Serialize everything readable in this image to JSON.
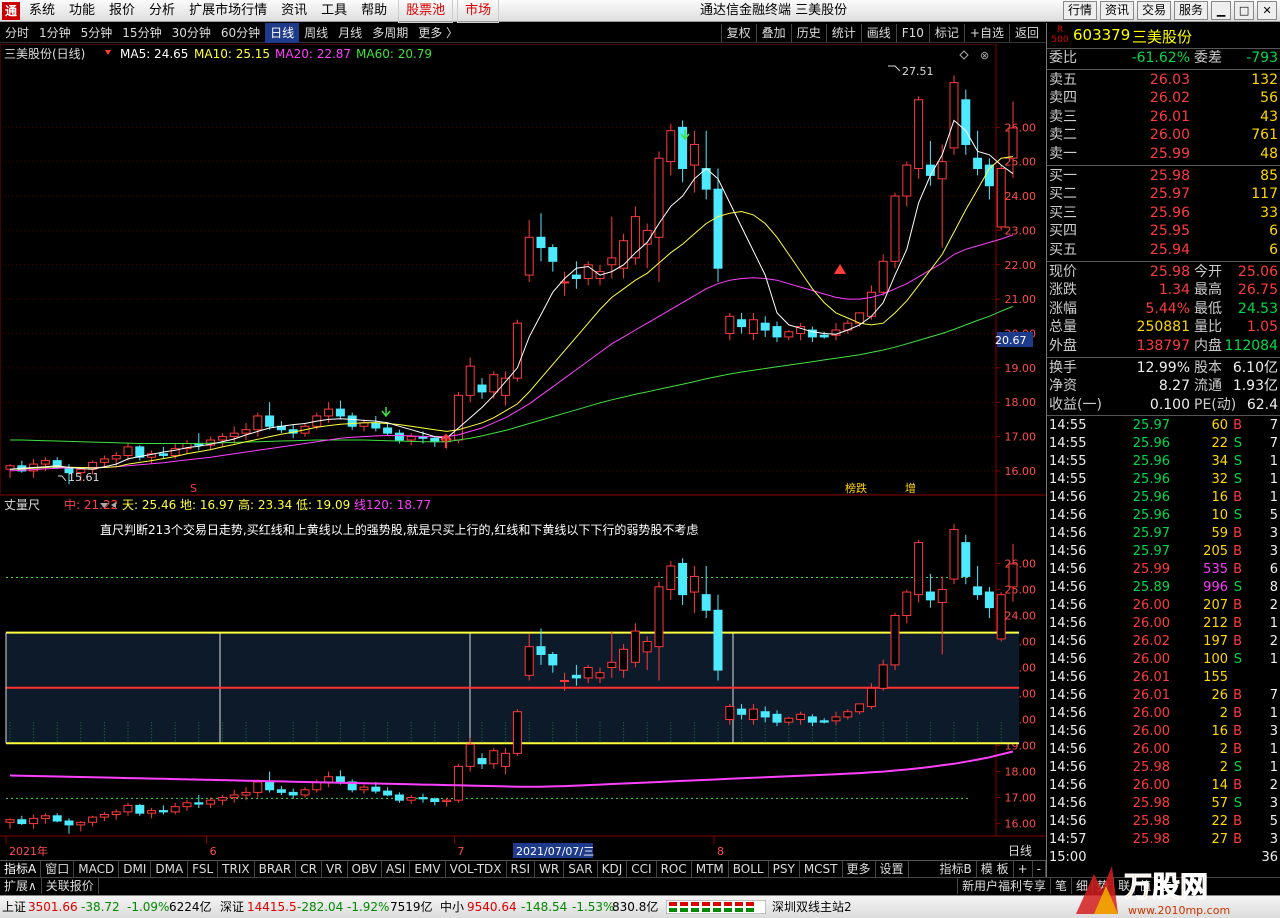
{
  "menu": {
    "items": [
      "系统",
      "功能",
      "报价",
      "分析",
      "扩展市场行情",
      "资讯",
      "工具",
      "帮助"
    ],
    "pool": "股票池",
    "market": "市场",
    "title": "通达信金融终端  三美股份",
    "rbtns": [
      "行情",
      "资讯",
      "交易",
      "服务"
    ]
  },
  "period": {
    "items": [
      "分时",
      "1分钟",
      "5分钟",
      "15分钟",
      "30分钟",
      "60分钟",
      "日线",
      "周线",
      "月线",
      "多周期",
      "更多 〉"
    ],
    "active": 6,
    "tools": [
      "复权",
      "叠加",
      "历史",
      "统计",
      "画线",
      "F10",
      "标记",
      "+自选",
      "返回"
    ]
  },
  "main_chart": {
    "title": "三美股份(日线)",
    "ma": [
      {
        "label": "MA5: 24.65",
        "color": "#ffffff"
      },
      {
        "label": "MA10: 25.15",
        "color": "#ffff40"
      },
      {
        "label": "MA20: 22.87",
        "color": "#ff40ff"
      },
      {
        "label": "MA60: 20.79",
        "color": "#40e040"
      }
    ],
    "high_label": "27.51",
    "low_label": "15.61",
    "tags": [
      {
        "text": "榜跌",
        "color": "#ffd700"
      },
      {
        "text": "增",
        "color": "#ffd700"
      }
    ],
    "price_tag": "20.67",
    "s_marker": "S"
  },
  "sub_chart": {
    "title": "丈量尺",
    "params": [
      {
        "label": "中: 21.22",
        "color": "#ff4040"
      },
      {
        "label": "天: 25.46",
        "color": "#ffff40"
      },
      {
        "label": "地: 16.97",
        "color": "#ffff40"
      },
      {
        "label": "高: 23.34",
        "color": "#ffff40"
      },
      {
        "label": "低: 19.09",
        "color": "#ffff40"
      },
      {
        "label": "线120: 18.77",
        "color": "#ff40ff"
      }
    ],
    "note": "直尺判断213个交易日走势,买红线和上黄线以上的强势股,就是只买上行的,红线和下黄线以下下行的弱势股不考虑"
  },
  "axis": {
    "x_labels": [
      {
        "label": "2021年",
        "i": 0
      },
      {
        "label": "6",
        "i": 17
      },
      {
        "label": "7",
        "i": 38
      },
      {
        "label": "8",
        "i": 60
      }
    ],
    "cursor_date": "2021/07/07/三",
    "period_label": "日线"
  },
  "chart_data": {
    "type": "candlestick",
    "title": "三美股份(日线)",
    "ylim_main": [
      15.3,
      27.9
    ],
    "ylim_sub": [
      15.6,
      27.9
    ],
    "sub_bands": {
      "top": 23.34,
      "mid": 21.22,
      "bottom": 19.09,
      "upper_dash": 25.46,
      "lower_dash": 16.97
    },
    "yticks": [
      16,
      17,
      18,
      19,
      20,
      21,
      22,
      23,
      24,
      25,
      26
    ],
    "ohlc": [
      [
        16.05,
        16.2,
        15.8,
        16.15
      ],
      [
        16.15,
        16.3,
        15.95,
        16.0
      ],
      [
        16.0,
        16.35,
        15.8,
        16.2
      ],
      [
        16.2,
        16.4,
        16.0,
        16.3
      ],
      [
        16.3,
        16.4,
        16.05,
        16.1
      ],
      [
        16.1,
        16.2,
        15.61,
        15.95
      ],
      [
        15.95,
        16.1,
        15.7,
        16.05
      ],
      [
        16.05,
        16.3,
        15.9,
        16.25
      ],
      [
        16.25,
        16.45,
        16.1,
        16.35
      ],
      [
        16.35,
        16.55,
        16.15,
        16.45
      ],
      [
        16.45,
        16.8,
        16.3,
        16.7
      ],
      [
        16.7,
        16.75,
        16.3,
        16.4
      ],
      [
        16.4,
        16.6,
        16.2,
        16.5
      ],
      [
        16.5,
        16.7,
        16.35,
        16.45
      ],
      [
        16.45,
        16.8,
        16.35,
        16.65
      ],
      [
        16.65,
        16.9,
        16.5,
        16.8
      ],
      [
        16.8,
        17.1,
        16.6,
        16.75
      ],
      [
        16.75,
        17.0,
        16.6,
        16.9
      ],
      [
        16.9,
        17.1,
        16.7,
        17.0
      ],
      [
        17.0,
        17.3,
        16.8,
        17.1
      ],
      [
        17.1,
        17.4,
        16.9,
        17.2
      ],
      [
        17.2,
        17.7,
        17.0,
        17.6
      ],
      [
        17.6,
        18.0,
        17.2,
        17.3
      ],
      [
        17.3,
        17.45,
        17.1,
        17.2
      ],
      [
        17.2,
        17.35,
        16.95,
        17.1
      ],
      [
        17.1,
        17.4,
        17.0,
        17.3
      ],
      [
        17.3,
        17.7,
        17.2,
        17.6
      ],
      [
        17.6,
        18.0,
        17.4,
        17.8
      ],
      [
        17.8,
        18.05,
        17.5,
        17.6
      ],
      [
        17.6,
        17.7,
        17.2,
        17.3
      ],
      [
        17.3,
        17.5,
        17.15,
        17.4
      ],
      [
        17.4,
        17.6,
        17.15,
        17.25
      ],
      [
        17.25,
        17.4,
        17.05,
        17.1
      ],
      [
        17.1,
        17.2,
        16.8,
        16.9
      ],
      [
        16.9,
        17.1,
        16.75,
        17.0
      ],
      [
        17.0,
        17.15,
        16.8,
        16.95
      ],
      [
        16.95,
        17.0,
        16.7,
        16.85
      ],
      [
        16.85,
        17.0,
        16.65,
        16.9
      ],
      [
        16.9,
        18.3,
        16.8,
        18.2
      ],
      [
        18.2,
        19.3,
        18.0,
        19.05
      ],
      [
        18.5,
        18.7,
        18.1,
        18.3
      ],
      [
        18.3,
        18.9,
        18.1,
        18.8
      ],
      [
        18.2,
        18.9,
        17.9,
        18.7
      ],
      [
        18.7,
        20.4,
        18.6,
        20.3
      ],
      [
        21.7,
        23.3,
        21.5,
        22.8
      ],
      [
        22.8,
        23.5,
        22.1,
        22.5
      ],
      [
        22.5,
        22.6,
        21.8,
        22.1
      ],
      [
        21.5,
        21.8,
        21.1,
        21.5
      ],
      [
        21.7,
        22.1,
        21.3,
        21.6
      ],
      [
        21.6,
        22.1,
        21.4,
        22.0
      ],
      [
        21.6,
        22.0,
        21.4,
        21.8
      ],
      [
        22.0,
        23.4,
        21.6,
        22.2
      ],
      [
        21.9,
        22.9,
        21.6,
        22.7
      ],
      [
        22.2,
        23.7,
        22.0,
        23.4
      ],
      [
        22.6,
        23.2,
        21.9,
        23.0
      ],
      [
        22.8,
        25.3,
        21.5,
        25.1
      ],
      [
        25.0,
        26.1,
        24.6,
        25.9
      ],
      [
        26.0,
        26.2,
        24.4,
        24.8
      ],
      [
        24.9,
        25.9,
        24.1,
        25.5
      ],
      [
        24.8,
        25.9,
        23.9,
        24.2
      ],
      [
        24.2,
        24.8,
        21.5,
        21.9
      ],
      [
        20.0,
        20.6,
        19.8,
        20.5
      ],
      [
        20.4,
        20.6,
        20.0,
        20.2
      ],
      [
        20.0,
        20.6,
        19.8,
        20.4
      ],
      [
        20.3,
        20.5,
        19.9,
        20.1
      ],
      [
        20.2,
        20.35,
        19.75,
        19.9
      ],
      [
        19.9,
        20.1,
        19.8,
        20.05
      ],
      [
        20.0,
        20.3,
        19.8,
        20.2
      ],
      [
        20.1,
        20.2,
        19.75,
        19.9
      ],
      [
        19.95,
        20.05,
        19.85,
        19.9
      ],
      [
        19.95,
        20.3,
        19.8,
        20.1
      ],
      [
        20.1,
        20.4,
        20.0,
        20.3
      ],
      [
        20.3,
        20.6,
        20.2,
        20.6
      ],
      [
        20.5,
        21.4,
        20.4,
        21.2
      ],
      [
        21.2,
        22.3,
        21.1,
        22.1
      ],
      [
        22.1,
        24.1,
        21.9,
        24.0
      ],
      [
        24.0,
        25.0,
        23.7,
        24.9
      ],
      [
        24.8,
        26.9,
        24.5,
        26.8
      ],
      [
        24.9,
        25.6,
        24.3,
        24.6
      ],
      [
        24.5,
        25.5,
        22.5,
        25.0
      ],
      [
        25.4,
        27.51,
        25.2,
        27.3
      ],
      [
        26.8,
        27.1,
        25.2,
        25.5
      ],
      [
        25.1,
        25.9,
        24.6,
        24.8
      ],
      [
        24.9,
        25.1,
        23.9,
        24.3
      ],
      [
        23.1,
        24.9,
        23.0,
        24.8
      ],
      [
        25.1,
        26.75,
        24.53,
        25.98
      ]
    ],
    "ma5": [
      16.05,
      16.08,
      16.1,
      16.12,
      16.15,
      16.1,
      16.07,
      16.05,
      16.12,
      16.2,
      16.35,
      16.42,
      16.48,
      16.55,
      16.6,
      16.68,
      16.72,
      16.78,
      16.85,
      16.93,
      17.05,
      17.15,
      17.25,
      17.3,
      17.35,
      17.38,
      17.45,
      17.5,
      17.52,
      17.5,
      17.47,
      17.45,
      17.4,
      17.3,
      17.2,
      17.1,
      17.0,
      16.95,
      17.25,
      17.55,
      17.85,
      18.2,
      18.6,
      19.0,
      19.9,
      20.55,
      21.2,
      21.6,
      21.9,
      21.95,
      21.7,
      21.8,
      22.0,
      22.35,
      22.65,
      23.2,
      23.7,
      24.0,
      24.5,
      24.8,
      24.5,
      23.8,
      23.1,
      22.4,
      21.7,
      20.6,
      20.25,
      20.15,
      20.05,
      20.0,
      19.98,
      20.1,
      20.25,
      20.5,
      20.9,
      21.7,
      22.45,
      23.8,
      24.6,
      25.2,
      26.2,
      25.9,
      25.3,
      25.2,
      24.9,
      24.65
    ],
    "ma10": [
      16.05,
      16.06,
      16.08,
      16.1,
      16.12,
      16.11,
      16.1,
      16.09,
      16.1,
      16.12,
      16.2,
      16.25,
      16.3,
      16.36,
      16.42,
      16.5,
      16.56,
      16.62,
      16.7,
      16.77,
      16.85,
      16.92,
      17.0,
      17.07,
      17.13,
      17.2,
      17.27,
      17.32,
      17.36,
      17.38,
      17.4,
      17.4,
      17.38,
      17.35,
      17.3,
      17.25,
      17.2,
      17.15,
      17.2,
      17.3,
      17.4,
      17.55,
      17.75,
      17.95,
      18.3,
      18.7,
      19.1,
      19.5,
      19.9,
      20.3,
      20.7,
      21.05,
      21.3,
      21.55,
      21.75,
      22.05,
      22.35,
      22.6,
      22.9,
      23.2,
      23.4,
      23.5,
      23.55,
      23.45,
      23.2,
      22.8,
      22.3,
      21.8,
      21.3,
      20.9,
      20.6,
      20.45,
      20.3,
      20.25,
      20.3,
      20.6,
      20.95,
      21.4,
      21.85,
      22.3,
      22.95,
      23.6,
      24.2,
      24.8,
      25.1,
      25.15
    ],
    "ma20": [
      16.0,
      16.02,
      16.04,
      16.06,
      16.08,
      16.09,
      16.1,
      16.1,
      16.11,
      16.12,
      16.15,
      16.18,
      16.21,
      16.24,
      16.28,
      16.32,
      16.36,
      16.4,
      16.45,
      16.5,
      16.55,
      16.6,
      16.65,
      16.7,
      16.75,
      16.8,
      16.85,
      16.9,
      16.95,
      16.98,
      17.0,
      17.02,
      17.03,
      17.03,
      17.02,
      17.0,
      17.0,
      17.0,
      17.05,
      17.15,
      17.25,
      17.4,
      17.55,
      17.75,
      17.95,
      18.2,
      18.45,
      18.7,
      18.95,
      19.2,
      19.45,
      19.7,
      19.9,
      20.1,
      20.3,
      20.5,
      20.7,
      20.9,
      21.1,
      21.3,
      21.45,
      21.55,
      21.6,
      21.62,
      21.6,
      21.55,
      21.45,
      21.35,
      21.25,
      21.15,
      21.05,
      21.0,
      21.0,
      21.05,
      21.15,
      21.3,
      21.45,
      21.65,
      21.85,
      22.05,
      22.3,
      22.45,
      22.55,
      22.65,
      22.75,
      22.87
    ],
    "ma60": [
      16.9,
      16.9,
      16.89,
      16.88,
      16.87,
      16.86,
      16.85,
      16.84,
      16.83,
      16.82,
      16.81,
      16.8,
      16.8,
      16.8,
      16.8,
      16.8,
      16.8,
      16.81,
      16.82,
      16.83,
      16.84,
      16.85,
      16.86,
      16.87,
      16.88,
      16.89,
      16.9,
      16.9,
      16.9,
      16.9,
      16.9,
      16.89,
      16.88,
      16.87,
      16.86,
      16.85,
      16.85,
      16.85,
      16.9,
      16.95,
      17.02,
      17.1,
      17.18,
      17.28,
      17.38,
      17.48,
      17.58,
      17.68,
      17.78,
      17.88,
      17.98,
      18.07,
      18.15,
      18.23,
      18.3,
      18.38,
      18.45,
      18.52,
      18.6,
      18.68,
      18.75,
      18.82,
      18.88,
      18.93,
      18.98,
      19.03,
      19.08,
      19.13,
      19.18,
      19.23,
      19.28,
      19.33,
      19.38,
      19.45,
      19.52,
      19.6,
      19.7,
      19.8,
      19.9,
      20.0,
      20.12,
      20.25,
      20.38,
      20.5,
      20.65,
      20.79
    ],
    "line120": [
      17.85,
      17.84,
      17.83,
      17.82,
      17.81,
      17.8,
      17.79,
      17.78,
      17.77,
      17.76,
      17.75,
      17.74,
      17.73,
      17.72,
      17.71,
      17.7,
      17.69,
      17.68,
      17.67,
      17.66,
      17.65,
      17.64,
      17.63,
      17.62,
      17.61,
      17.6,
      17.59,
      17.58,
      17.57,
      17.56,
      17.55,
      17.54,
      17.53,
      17.52,
      17.51,
      17.5,
      17.49,
      17.48,
      17.47,
      17.46,
      17.45,
      17.44,
      17.43,
      17.42,
      17.42,
      17.42,
      17.43,
      17.44,
      17.46,
      17.48,
      17.5,
      17.52,
      17.54,
      17.56,
      17.58,
      17.6,
      17.62,
      17.64,
      17.66,
      17.68,
      17.7,
      17.72,
      17.74,
      17.76,
      17.78,
      17.8,
      17.82,
      17.84,
      17.86,
      17.88,
      17.9,
      17.92,
      17.94,
      17.97,
      18.0,
      18.04,
      18.08,
      18.13,
      18.18,
      18.24,
      18.3,
      18.38,
      18.46,
      18.55,
      18.66,
      18.77
    ]
  },
  "quote": {
    "code": "603379",
    "name": "三美股份",
    "r_label": "R",
    "market_label": "500",
    "rows_top": [
      {
        "l": "委比",
        "m": "-61.62%",
        "mc": "grn",
        "l2": "委差",
        "r": "-793",
        "rc": "grn"
      }
    ],
    "sells": [
      {
        "l": "卖五",
        "p": "26.03",
        "v": "132"
      },
      {
        "l": "卖四",
        "p": "26.02",
        "v": "56"
      },
      {
        "l": "卖三",
        "p": "26.01",
        "v": "43"
      },
      {
        "l": "卖二",
        "p": "26.00",
        "v": "761"
      },
      {
        "l": "卖一",
        "p": "25.99",
        "v": "48"
      }
    ],
    "buys": [
      {
        "l": "买一",
        "p": "25.98",
        "v": "85"
      },
      {
        "l": "买二",
        "p": "25.97",
        "v": "117"
      },
      {
        "l": "买三",
        "p": "25.96",
        "v": "33"
      },
      {
        "l": "买四",
        "p": "25.95",
        "v": "6"
      },
      {
        "l": "买五",
        "p": "25.94",
        "v": "6"
      }
    ],
    "stats": [
      {
        "l": "现价",
        "m": "25.98",
        "mc": "red",
        "l2": "今开",
        "r": "25.06",
        "rc": "red"
      },
      {
        "l": "涨跌",
        "m": "1.34",
        "mc": "red",
        "l2": "最高",
        "r": "26.75",
        "rc": "red"
      },
      {
        "l": "涨幅",
        "m": "5.44%",
        "mc": "red",
        "l2": "最低",
        "r": "24.53",
        "rc": "grn"
      },
      {
        "l": "总量",
        "m": "250881",
        "mc": "yel",
        "l2": "量比",
        "r": "1.05",
        "rc": "red"
      },
      {
        "l": "外盘",
        "m": "138797",
        "mc": "red",
        "l2": "内盘",
        "r": "112084",
        "rc": "grn"
      }
    ],
    "stats2": [
      {
        "l": "换手",
        "m": "12.99%",
        "mc": "wht",
        "l2": "股本",
        "r": "6.10亿",
        "rc": "wht"
      },
      {
        "l": "净资",
        "m": "8.27",
        "mc": "wht",
        "l2": "流通",
        "r": "1.93亿",
        "rc": "wht"
      },
      {
        "l": "收益(一)",
        "m": "0.100",
        "mc": "wht",
        "l2": "PE(动)",
        "r": "62.4",
        "rc": "wht"
      }
    ]
  },
  "ticks": [
    [
      "14:55",
      "25.97",
      "60",
      "B",
      "7"
    ],
    [
      "14:55",
      "25.96",
      "22",
      "S",
      "7"
    ],
    [
      "14:55",
      "25.96",
      "34",
      "S",
      "1"
    ],
    [
      "14:55",
      "25.96",
      "32",
      "S",
      "1"
    ],
    [
      "14:56",
      "25.96",
      "16",
      "B",
      "1"
    ],
    [
      "14:56",
      "25.96",
      "10",
      "S",
      "5"
    ],
    [
      "14:56",
      "25.97",
      "59",
      "B",
      "3"
    ],
    [
      "14:56",
      "25.97",
      "205",
      "B",
      "3"
    ],
    [
      "14:56",
      "25.99",
      "535",
      "B",
      "6"
    ],
    [
      "14:56",
      "25.89",
      "996",
      "S",
      "8"
    ],
    [
      "14:56",
      "26.00",
      "207",
      "B",
      "2"
    ],
    [
      "14:56",
      "26.00",
      "212",
      "B",
      "1"
    ],
    [
      "14:56",
      "26.02",
      "197",
      "B",
      "2"
    ],
    [
      "14:56",
      "26.00",
      "100",
      "S",
      "1"
    ],
    [
      "14:56",
      "26.01",
      "155",
      "",
      ""
    ],
    [
      "14:56",
      "26.01",
      "26",
      "B",
      "7"
    ],
    [
      "14:56",
      "26.00",
      "2",
      "B",
      "1"
    ],
    [
      "14:56",
      "26.00",
      "16",
      "B",
      "3"
    ],
    [
      "14:56",
      "26.00",
      "2",
      "B",
      "1"
    ],
    [
      "14:56",
      "25.98",
      "2",
      "S",
      "1"
    ],
    [
      "14:56",
      "26.00",
      "14",
      "B",
      "2"
    ],
    [
      "14:56",
      "25.98",
      "57",
      "S",
      "3"
    ],
    [
      "14:56",
      "25.98",
      "22",
      "B",
      "5"
    ],
    [
      "14:57",
      "25.98",
      "27",
      "B",
      "3"
    ],
    [
      "15:00",
      "",
      "",
      "",
      "36"
    ]
  ],
  "indicators": {
    "items": [
      "指标A",
      "窗口",
      "MACD",
      "DMI",
      "DMA",
      "FSL",
      "TRIX",
      "BRAR",
      "CR",
      "VR",
      "OBV",
      "ASI",
      "EMV",
      "VOL-TDX",
      "RSI",
      "WR",
      "SAR",
      "KDJ",
      "CCI",
      "ROC",
      "MTM",
      "BOLL",
      "PSY",
      "MCST",
      "更多",
      "设置"
    ],
    "right": [
      "指标B",
      "模 板",
      "+",
      "-"
    ]
  },
  "bar2": {
    "left": [
      "扩展∧",
      "关联报价"
    ],
    "right": [
      "新用户福利专享",
      "笔",
      "细",
      "势",
      "联",
      "值",
      "主"
    ]
  },
  "status": {
    "sh_label": "上证",
    "sh": "3501.66",
    "sh_chg": "-38.72",
    "sh_pct": "-1.09%",
    "sh_amt": "6224亿",
    "sz_label": "深证",
    "sz": "14415.5",
    "sz_chg": "-282.04",
    "sz_pct": "-1.92%",
    "sz_amt": "7519亿",
    "zx_label": "中小",
    "zx": "9540.64",
    "zx_chg": "-148.54",
    "zx_pct": "-1.53%",
    "zx_amt": "830.8亿",
    "site": "深圳双线主站2"
  },
  "watermark": {
    "brand": "万股网",
    "url": "www.2010mp.com"
  },
  "colors": {
    "up": "#ff3b3b",
    "down": "#4de9ff",
    "ma5": "#ffffff",
    "ma10": "#ffff40",
    "ma20": "#ff40ff",
    "ma60": "#40e040"
  }
}
